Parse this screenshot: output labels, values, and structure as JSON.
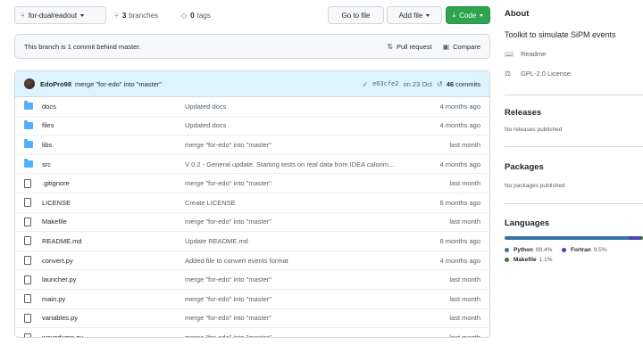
{
  "toolbar": {
    "branch": "for-dualreadout",
    "branches_count": "3",
    "branches_label": "branches",
    "tags_count": "0",
    "tags_label": "tags",
    "go_to_file": "Go to file",
    "add_file": "Add file",
    "code": "Code"
  },
  "banner": {
    "text": "This branch is 1 commit behind master.",
    "pull_request": "Pull request",
    "compare": "Compare"
  },
  "commit": {
    "author": "EdoPro98",
    "message": "merge \"for-edo\" into \"master\"",
    "sha": "e63cfe2",
    "date": "on 23 Oct",
    "count": "46",
    "count_label": "commits"
  },
  "files": [
    {
      "type": "folder",
      "name": "docs",
      "message": "Updated docs",
      "date": "4 months ago"
    },
    {
      "type": "folder",
      "name": "files",
      "message": "Updated docs",
      "date": "4 months ago"
    },
    {
      "type": "folder",
      "name": "libs",
      "message": "merge \"for-edo\" into \"master\"",
      "date": "last month"
    },
    {
      "type": "folder",
      "name": "src",
      "message": "V 0.2 - General update. Starting tests on real data from IDEA calorim...",
      "date": "4 months ago"
    },
    {
      "type": "file",
      "name": ".gitignore",
      "message": "merge \"for-edo\" into \"master\"",
      "date": "last month"
    },
    {
      "type": "file",
      "name": "LICENSE",
      "message": "Create LICENSE",
      "date": "6 months ago"
    },
    {
      "type": "file",
      "name": "Makefile",
      "message": "merge \"for-edo\" into \"master\"",
      "date": "last month"
    },
    {
      "type": "file",
      "name": "README.md",
      "message": "Update README.md",
      "date": "6 months ago"
    },
    {
      "type": "file",
      "name": "convert.py",
      "message": "Added file to convert events format",
      "date": "4 months ago"
    },
    {
      "type": "file",
      "name": "launcher.py",
      "message": "merge \"for-edo\" into \"master\"",
      "date": "last month"
    },
    {
      "type": "file",
      "name": "main.py",
      "message": "merge \"for-edo\" into \"master\"",
      "date": "last month"
    },
    {
      "type": "file",
      "name": "variables.py",
      "message": "merge \"for-edo\" into \"master\"",
      "date": "last month"
    },
    {
      "type": "file",
      "name": "wavedump.py",
      "message": "merge \"for-edo\" into \"master\"",
      "date": "last month"
    }
  ],
  "sidebar": {
    "about_title": "About",
    "description": "Toolkit to simulate SiPM events",
    "readme": "Readme",
    "license": "GPL-2.0 License",
    "releases_title": "Releases",
    "releases_empty": "No releases published",
    "packages_title": "Packages",
    "packages_empty": "No packages published",
    "languages_title": "Languages",
    "languages": [
      {
        "name": "Python",
        "percent": "89.4%",
        "value": 89.4,
        "color": "#3572A5"
      },
      {
        "name": "Fortran",
        "percent": "9.5%",
        "value": 9.5,
        "color": "#4d41b1"
      },
      {
        "name": "Makefile",
        "percent": "1.1%",
        "value": 1.1,
        "color": "#427819"
      }
    ]
  }
}
